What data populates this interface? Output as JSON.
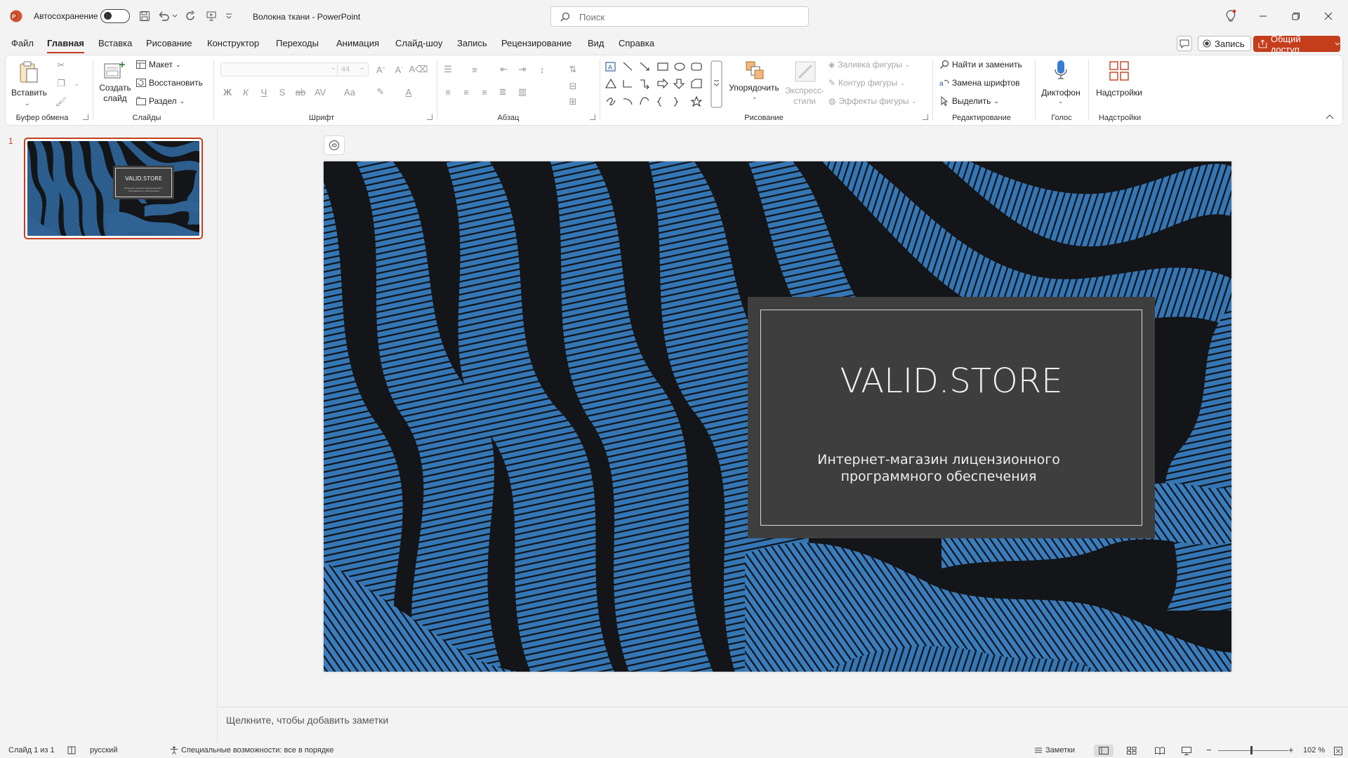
{
  "titlebar": {
    "autosave_label": "Автосохранение",
    "document_title": "Волокна ткани  -  PowerPoint",
    "search_placeholder": "Поиск"
  },
  "tabs": [
    {
      "label": "Файл"
    },
    {
      "label": "Главная"
    },
    {
      "label": "Вставка"
    },
    {
      "label": "Рисование"
    },
    {
      "label": "Конструктор"
    },
    {
      "label": "Переходы"
    },
    {
      "label": "Анимация"
    },
    {
      "label": "Слайд-шоу"
    },
    {
      "label": "Запись"
    },
    {
      "label": "Рецензирование"
    },
    {
      "label": "Вид"
    },
    {
      "label": "Справка"
    }
  ],
  "actions": {
    "record_label": "Запись",
    "share_label": "Общий доступ"
  },
  "ribbon": {
    "clipboard": {
      "paste": "Вставить",
      "group": "Буфер обмена"
    },
    "slides": {
      "new_slide": "Создать слайд",
      "layout": "Макет",
      "reset": "Восстановить",
      "section": "Раздел",
      "group": "Слайды"
    },
    "font": {
      "size": "44",
      "group": "Шрифт"
    },
    "paragraph": {
      "group": "Абзац"
    },
    "drawing": {
      "arrange": "Упорядочить",
      "quick_styles": "Экспресс-стили",
      "fill": "Заливка фигуры",
      "outline": "Контур фигуры",
      "effects": "Эффекты фигуры",
      "group": "Рисование"
    },
    "editing": {
      "find": "Найти и заменить",
      "replace_fonts": "Замена шрифтов",
      "select": "Выделить",
      "group": "Редактирование"
    },
    "voice": {
      "dictate": "Диктофон",
      "group": "Голос"
    },
    "addins": {
      "addins": "Надстройки",
      "group": "Надстройки"
    }
  },
  "thumbnails": [
    {
      "number": "1",
      "title": "VALID.STORE",
      "subtitle": "Интернет-магазин лицензионного программного обеспечения"
    }
  ],
  "slide": {
    "title": "VALID.STORE",
    "subtitle": "Интернет-магазин лицензионного программного обеспечения"
  },
  "notes": {
    "placeholder": "Щелкните, чтобы добавить заметки"
  },
  "statusbar": {
    "slide_counter": "Слайд 1 из 1",
    "language": "русский",
    "accessibility": "Специальные возможности: все в порядке",
    "notes_button": "Заметки",
    "zoom": "102 %"
  },
  "colors": {
    "accent": "#c43e1c",
    "slide_background": "#3576b4",
    "title_card": "#3e3e3e"
  }
}
